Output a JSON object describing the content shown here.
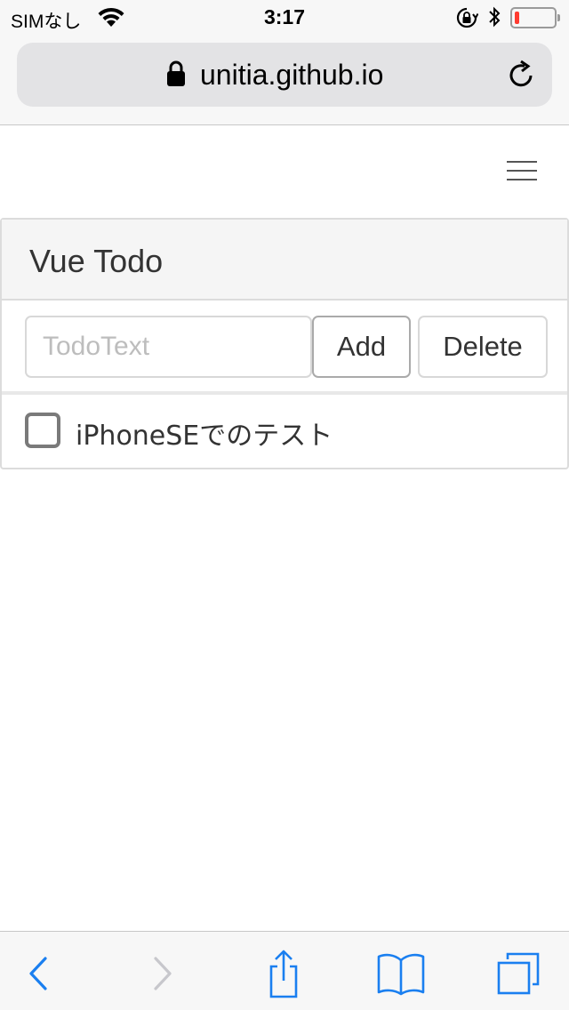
{
  "status_bar": {
    "carrier": "SIMなし",
    "time": "3:17"
  },
  "browser": {
    "url": "unitia.github.io",
    "accent_color": "#1a7ff0",
    "disabled_color": "#c7c7cc"
  },
  "navbar": {
    "menu_icon": "hamburger-icon"
  },
  "panel": {
    "title": "Vue Todo",
    "input": {
      "placeholder": "TodoText",
      "value": ""
    },
    "add_label": "Add",
    "delete_label": "Delete"
  },
  "todos": [
    {
      "text": "iPhoneSEでのテスト",
      "checked": false
    }
  ],
  "toolbar": {
    "icons": [
      "back-icon",
      "forward-icon",
      "share-icon",
      "bookmarks-icon",
      "tabs-icon"
    ]
  }
}
